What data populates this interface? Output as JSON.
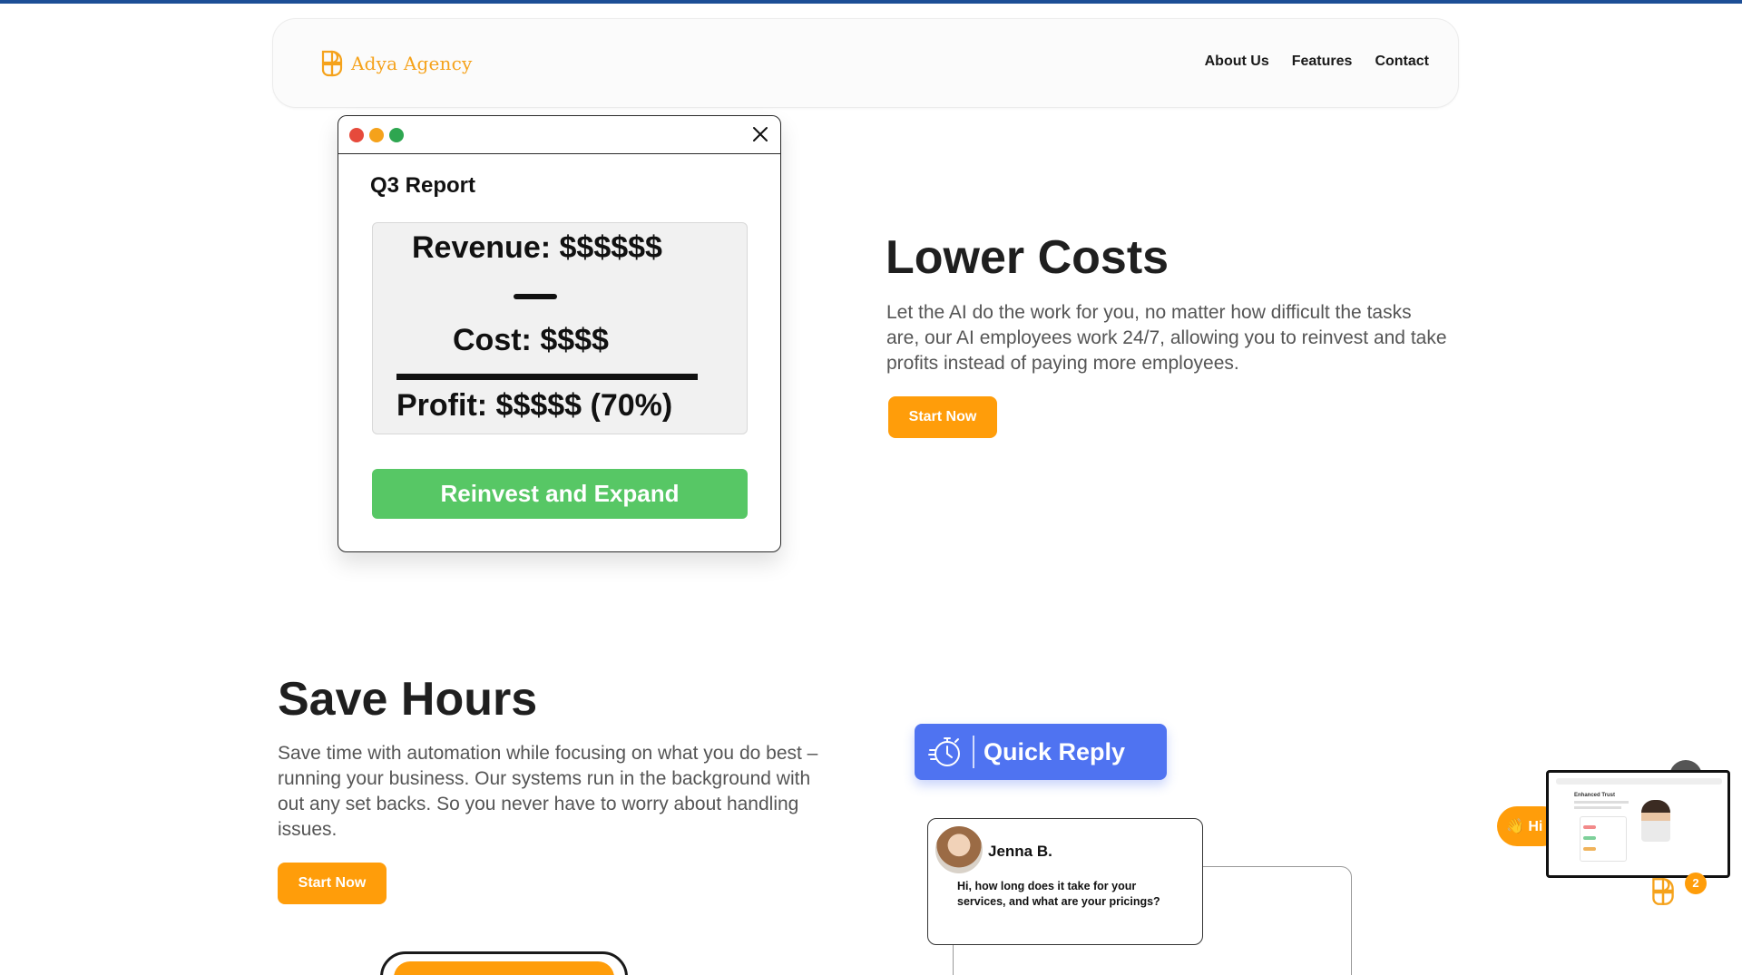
{
  "nav": {
    "brand": "Adya Agency",
    "links": [
      {
        "label": "About Us"
      },
      {
        "label": "Features"
      },
      {
        "label": "Contact"
      }
    ]
  },
  "report_window": {
    "title": "Q3 Report",
    "revenue": "Revenue: $$$$$$",
    "cost": "Cost: $$$$",
    "profit": "Profit: $$$$$ (70%)",
    "button": "Reinvest and Expand"
  },
  "lower_costs": {
    "heading": "Lower Costs",
    "body": "Let the AI do the work for you, no matter how difficult the tasks are, our AI employees work 24/7, allowing you to reinvest and take profits instead of paying more employees.",
    "cta": "Start Now"
  },
  "save_hours": {
    "heading": "Save Hours",
    "body": "Save time with automation while focusing on what you do best – running your business. Our systems run in the background with out any set backs. So you never have to worry about handling issues.",
    "cta": "Start Now"
  },
  "quick_reply": {
    "label": "Quick Reply"
  },
  "chat": {
    "name": "Jenna B.",
    "message": "Hi, how long does it take for your services, and what are your pricings?"
  },
  "widget": {
    "greeting": "👋 Hi",
    "preview_title": "Enhanced Trust",
    "badge_count": "2"
  },
  "colors": {
    "brand_orange": "#ff9d0a",
    "top_strip": "#1d4f96",
    "reinvest_green": "#57c765",
    "quick_reply_blue": "#4f73f1"
  }
}
